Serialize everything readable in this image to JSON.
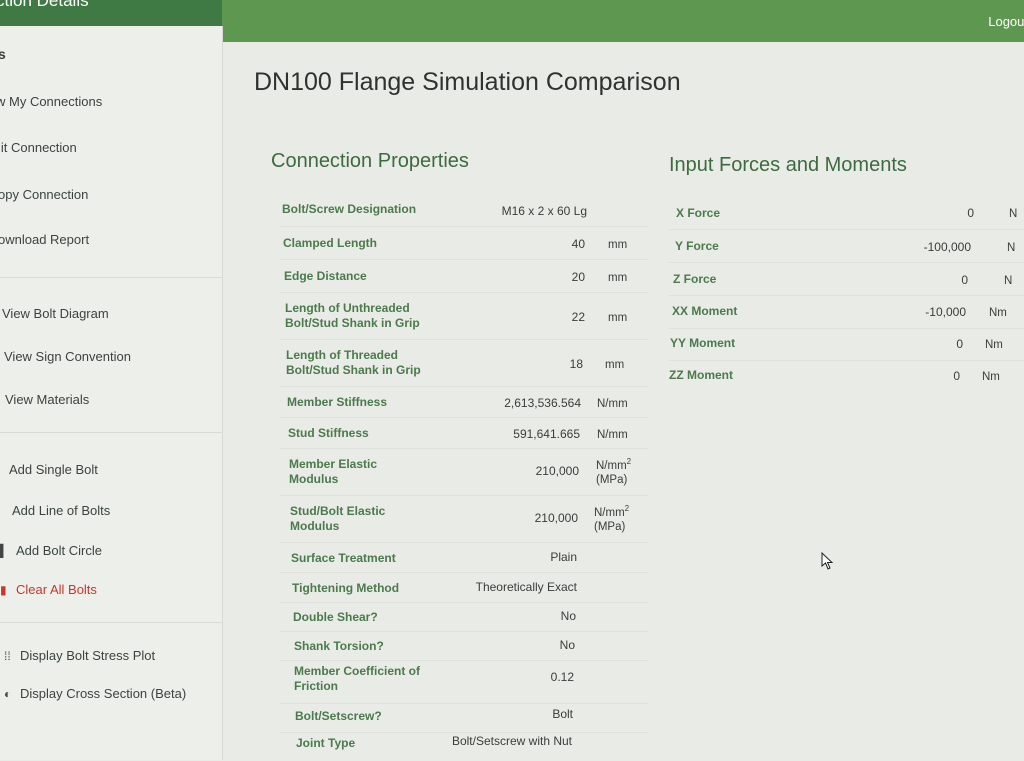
{
  "header": {
    "side_title": "ction Details",
    "logout_label": "Logout"
  },
  "sidebar": {
    "section_title": "s",
    "items": [
      {
        "label": "w My Connections"
      },
      {
        "label": "lit Connection"
      },
      {
        "label": "opy Connection"
      },
      {
        "label": "ownload Report"
      },
      {
        "label": "View Bolt Diagram"
      },
      {
        "label": "View Sign Convention"
      },
      {
        "label": "View Materials"
      },
      {
        "label": "Add Single Bolt"
      },
      {
        "label": "Add Line of Bolts"
      },
      {
        "label": "Add Bolt Circle"
      },
      {
        "label": "Clear All Bolts"
      },
      {
        "label": "Display Bolt Stress Plot"
      },
      {
        "label": "Display Cross Section (Beta)"
      }
    ]
  },
  "main": {
    "page_title": "DN100 Flange Simulation Comparison",
    "connection": {
      "title": "Connection Properties",
      "rows": [
        {
          "label": "Bolt/Screw Designation",
          "value": "M16 x 2 x 60 Lg",
          "unit": ""
        },
        {
          "label": "Clamped Length",
          "value": "40",
          "unit": "mm"
        },
        {
          "label": "Edge Distance",
          "value": "20",
          "unit": "mm"
        },
        {
          "label": "Length of Unthreaded Bolt/Stud Shank in Grip",
          "value": "22",
          "unit": "mm"
        },
        {
          "label": "Length of Threaded Bolt/Stud Shank in Grip",
          "value": "18",
          "unit": "mm"
        },
        {
          "label": "Member Stiffness",
          "value": "2,613,536.564",
          "unit": "N/mm"
        },
        {
          "label": "Stud Stiffness",
          "value": "591,641.665",
          "unit": "N/mm"
        },
        {
          "label": "Member Elastic Modulus",
          "value": "210,000",
          "unit": "N/mm",
          "unit_sup": "2",
          "unit_sub": "(MPa)"
        },
        {
          "label": "Stud/Bolt Elastic Modulus",
          "value": "210,000",
          "unit": "N/mm",
          "unit_sup": "2",
          "unit_sub": "(MPa)"
        },
        {
          "label": "Surface Treatment",
          "value": "Plain",
          "unit": ""
        },
        {
          "label": "Tightening Method",
          "value": "Theoretically Exact",
          "unit": ""
        },
        {
          "label": "Double Shear?",
          "value": "No",
          "unit": ""
        },
        {
          "label": "Shank Torsion?",
          "value": "No",
          "unit": ""
        },
        {
          "label": "Member Coefficient of Friction",
          "value": "0.12",
          "unit": ""
        },
        {
          "label": "Bolt/Setscrew?",
          "value": "Bolt",
          "unit": ""
        },
        {
          "label": "Joint Type",
          "value": "Bolt/Setscrew with Nut",
          "unit": ""
        }
      ]
    },
    "forces": {
      "title": "Input Forces and Moments",
      "rows": [
        {
          "label": "X Force",
          "value": "0",
          "unit": "N"
        },
        {
          "label": "Y Force",
          "value": "-100,000",
          "unit": "N"
        },
        {
          "label": "Z Force",
          "value": "0",
          "unit": "N"
        },
        {
          "label": "XX Moment",
          "value": "-10,000",
          "unit": "Nm"
        },
        {
          "label": "YY Moment",
          "value": "0",
          "unit": "Nm"
        },
        {
          "label": "ZZ Moment",
          "value": "0",
          "unit": "Nm"
        }
      ]
    }
  },
  "icons": {
    "circle_icon": "bolt-circle-icon",
    "trash_icon": "trash-icon",
    "plot_icon": "dots-grid-icon",
    "cross_section_icon": "half-circle-icon"
  },
  "colors": {
    "header_dark": "#3f7a45",
    "header": "#5e9850",
    "label_green": "#4b7a4c",
    "danger": "#c8362e"
  }
}
